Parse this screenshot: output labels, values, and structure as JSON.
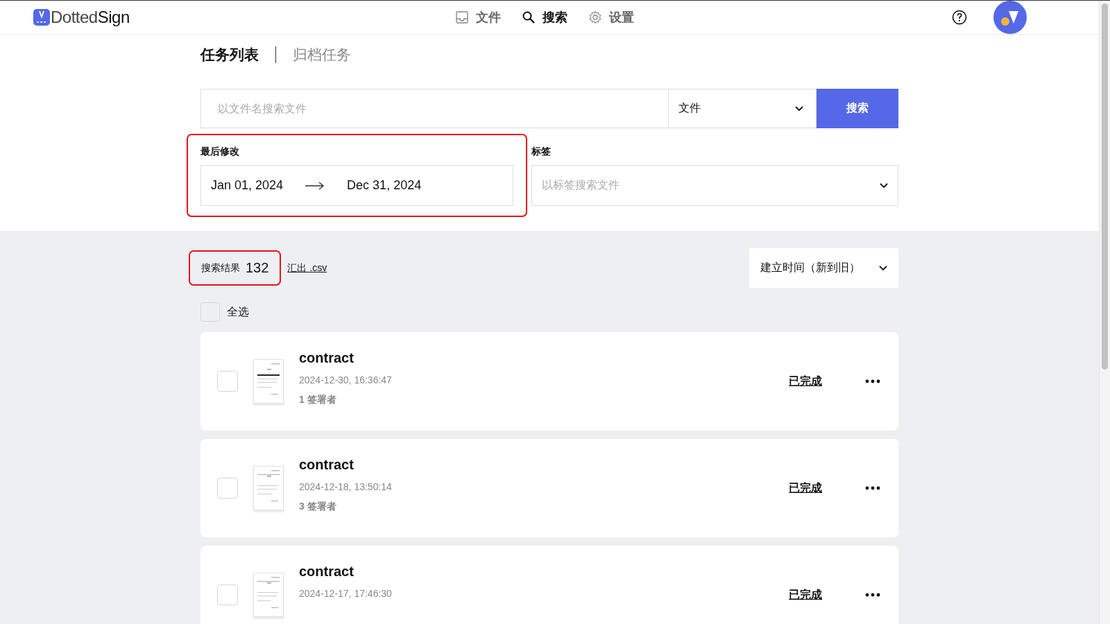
{
  "header": {
    "logo": {
      "light": "Dotted",
      "bold": "Sign"
    },
    "nav": [
      {
        "kind": "file",
        "label": "文件",
        "selected": false
      },
      {
        "kind": "search",
        "label": "搜索",
        "selected": true
      },
      {
        "kind": "settings",
        "label": "设置",
        "selected": false
      }
    ]
  },
  "tabs": [
    {
      "label": "任务列表",
      "selected": true
    },
    {
      "label": "归档任务",
      "selected": false
    }
  ],
  "search": {
    "placeholder": "以文件名搜索文件",
    "scope": "文件",
    "button": "搜索"
  },
  "date_filter": {
    "label": "最后修改",
    "from": "Jan 01, 2024",
    "to": "Dec 31, 2024",
    "highlighted": true
  },
  "tag_filter": {
    "label": "标签",
    "placeholder": "以标签搜索文件"
  },
  "results": {
    "label": "搜索结果",
    "count": "132",
    "highlighted": true,
    "export": "汇出 .csv",
    "sort": "建立时间（新到旧）"
  },
  "select_all": {
    "label": "全选",
    "checked": false
  },
  "tasks": [
    {
      "name": "contract",
      "time": "2024-12-30, 16:36:47",
      "signers": "1 签署者",
      "status": "已完成",
      "checked": false
    },
    {
      "name": "contract",
      "time": "2024-12-18, 13:50:14",
      "signers": "3 签署者",
      "status": "已完成",
      "checked": false
    },
    {
      "name": "contract",
      "time": "2024-12-17, 17:46:30",
      "status": "已完成",
      "checked": false
    }
  ]
}
